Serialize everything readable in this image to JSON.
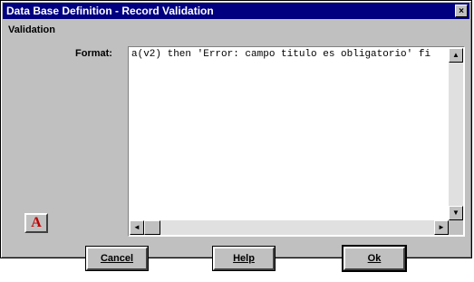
{
  "window": {
    "title": "Data Base Definition - Record Validation",
    "close_glyph": "×"
  },
  "validation": {
    "group_label": "Validation",
    "format_label": "Format:",
    "format_value": "a(v2) then 'Error: campo titulo es obligatorio' fi"
  },
  "scrollbars": {
    "up": "▲",
    "down": "▼",
    "left": "◄",
    "right": "►"
  },
  "font_button": {
    "label": "A",
    "color": "#c00000"
  },
  "buttons": {
    "cancel": "Cancel",
    "help": "Help",
    "ok": "Ok"
  }
}
